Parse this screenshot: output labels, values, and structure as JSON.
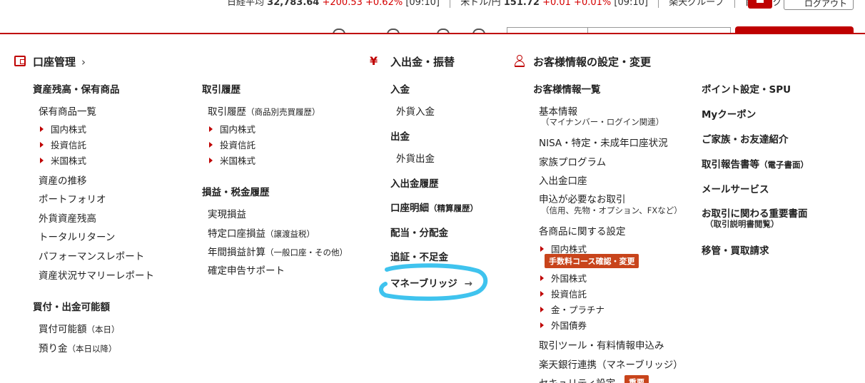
{
  "ticker": {
    "nikkei_label": "日経平均",
    "nikkei_value": "32,783.64",
    "nikkei_change": "+200.53 +0.62%",
    "nikkei_time": "[09:10]",
    "usdjpy_label": "米ドル/円",
    "usdjpy_value": "151.72",
    "usdjpy_change": "+0.01 +0.01%",
    "usdjpy_time": "[09:10]",
    "group_label": "楽天グループ",
    "autologout_label": "自動ログアウト",
    "logout_label": "ログアウト"
  },
  "account": {
    "title": "口座管理",
    "holdings_head": "資産残高・保有商品",
    "holdings_list": "保有商品一覧",
    "holdings_sub": [
      "国内株式",
      "投資信託",
      "米国株式"
    ],
    "asset_trend": "資産の推移",
    "portfolio": "ポートフォリオ",
    "fx_balance": "外貨資産残高",
    "total_return": "トータルリターン",
    "performance": "パフォーマンスレポート",
    "summary": "資産状況サマリーレポート",
    "buying_head": "買付・出金可能額",
    "buying_power": "買付可能額",
    "buying_power_note": "（本日）",
    "deposit": "預り金",
    "deposit_note": "（本日以降）"
  },
  "history": {
    "trade_head": "取引履歴",
    "trade_hist": "取引履歴",
    "trade_hist_note": "（商品別売買履歴）",
    "trade_sub": [
      "国内株式",
      "投資信託",
      "米国株式"
    ],
    "tax_head": "損益・税金履歴",
    "realized": "実現損益",
    "specific": "特定口座損益",
    "specific_note": "（譲渡益税）",
    "annual": "年間損益計算",
    "annual_note": "（一般口座・その他）",
    "tax_return": "確定申告サポート"
  },
  "funds": {
    "title": "入出金・振替",
    "deposit_head": "入金",
    "fx_deposit": "外貨入金",
    "withdraw_head": "出金",
    "fx_withdraw": "外貨出金",
    "history": "入出金履歴",
    "statement": "口座明細",
    "statement_note": "（精算履歴）",
    "dividend": "配当・分配金",
    "margin_call": "追証・不足金",
    "money_bridge": "マネーブリッジ"
  },
  "customer": {
    "title": "お客様情報の設定・変更",
    "info_head": "お客様情報一覧",
    "basic": "基本情報",
    "basic_note": "（マイナンバー・ログイン関連）",
    "nisa": "NISA・特定・未成年口座状況",
    "family": "家族プログラム",
    "bank": "入出金口座",
    "apply": "申込が必要なお取引",
    "apply_note": "（信用、先物・オプション、FXなど）",
    "product_settings": "各商品に関する設定",
    "domestic_stock": "国内株式",
    "fee_badge": "手数料コース確認・変更",
    "product_sub": [
      "外国株式",
      "投資信託",
      "金・プラチナ",
      "外国債券"
    ],
    "tools": "取引ツール・有料情報申込み",
    "rakuten_bank": "楽天銀行連携（マネーブリッジ）",
    "security": "セキュリティ設定",
    "important_badge": "重要"
  },
  "side": {
    "points": "ポイント設定・SPU",
    "coupon": "Myクーポン",
    "referral": "ご家族・お友達紹介",
    "reports": "取引報告書等",
    "reports_note": "（電子書面）",
    "mail": "メールサービス",
    "important_docs": "お取引に関わる重要書面",
    "important_docs_note": "（取引説明書閲覧）",
    "transfer": "移管・買取請求"
  },
  "colors": {
    "brand_red": "#bf0000",
    "badge_orange": "#c8441b",
    "highlight_blue": "#3fc3ee"
  }
}
